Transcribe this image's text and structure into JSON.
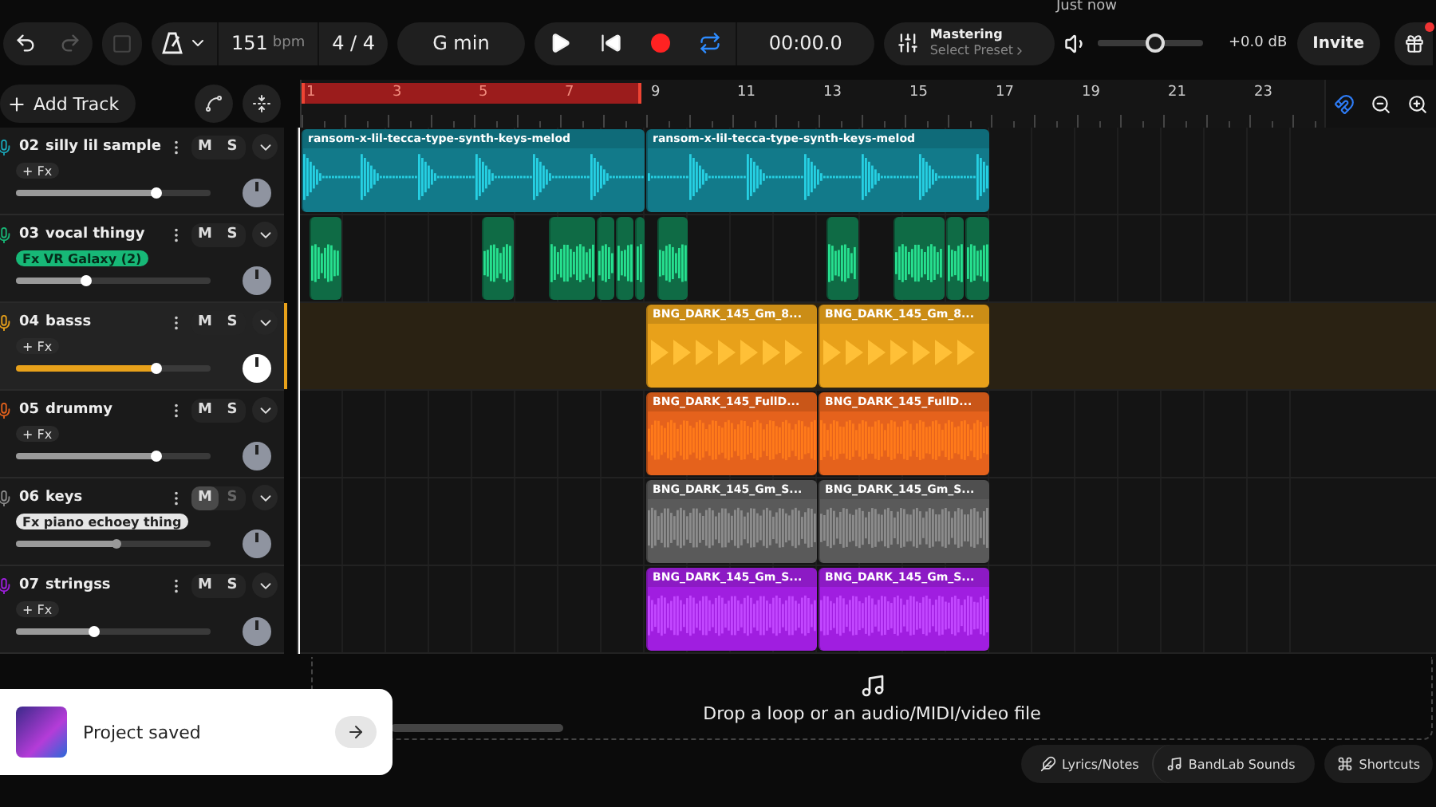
{
  "top_strip": {
    "status": "Just now"
  },
  "toolbar": {
    "tempo": "151",
    "tempo_unit": "bpm",
    "time_signature": "4 / 4",
    "key": "G min",
    "loop_on": true,
    "time": "00:00.0",
    "mastering": {
      "title": "Mastering",
      "preset": "Select Preset"
    },
    "master_volume": {
      "level": 0.55,
      "reading": "+0.0 dB"
    },
    "invite": "Invite"
  },
  "track_header": {
    "add_track": "Add Track"
  },
  "ruler": {
    "bars": [
      "1",
      "3",
      "5",
      "7",
      "9",
      "11",
      "13",
      "15",
      "17",
      "19",
      "21",
      "23"
    ],
    "loop_region": {
      "level": 0.333
    }
  },
  "tracks": [
    {
      "number": "02",
      "name": "silly lil sample",
      "color": "#1aa6b8",
      "fx": {
        "kind": "add",
        "label": "+ Fx"
      },
      "muted": false,
      "selected": false,
      "level": 0.72,
      "mute_label": "M",
      "solo_label": "S",
      "clips": [
        {
          "label": "ransom-x-lil-tecca-type-synth-keys-melod"
        },
        {
          "label": "ransom-x-lil-tecca-type-synth-keys-melod"
        }
      ]
    },
    {
      "number": "03",
      "name": "vocal thingy",
      "color": "#17b877",
      "fx": {
        "kind": "chip",
        "label": "Fx VR Galaxy (2)"
      },
      "muted": false,
      "selected": false,
      "level": 0.36,
      "mute_label": "M",
      "solo_label": "S"
    },
    {
      "number": "04",
      "name": "basss",
      "color": "#e8a11a",
      "fx": {
        "kind": "add",
        "label": "+ Fx"
      },
      "muted": false,
      "selected": true,
      "level": 0.72,
      "mute_label": "M",
      "solo_label": "S",
      "clips": [
        {
          "label": "BNG_DARK_145_Gm_8..."
        },
        {
          "label": "BNG_DARK_145_Gm_8..."
        }
      ]
    },
    {
      "number": "05",
      "name": "drummy",
      "color": "#e5621c",
      "fx": {
        "kind": "add",
        "label": "+ Fx"
      },
      "muted": false,
      "selected": false,
      "level": 0.72,
      "mute_label": "M",
      "solo_label": "S",
      "clips": [
        {
          "label": "BNG_DARK_145_FullD..."
        },
        {
          "label": "BNG_DARK_145_FullD..."
        }
      ]
    },
    {
      "number": "06",
      "name": "keys",
      "color": "#8a8a8a",
      "fx": {
        "kind": "chip",
        "label": "Fx piano echoey thing"
      },
      "muted": true,
      "selected": false,
      "level": 0.52,
      "mute_label": "M",
      "solo_label": "S",
      "clips": [
        {
          "label": "BNG_DARK_145_Gm_S..."
        },
        {
          "label": "BNG_DARK_145_Gm_S..."
        }
      ]
    },
    {
      "number": "07",
      "name": "stringss",
      "color": "#a01ee0",
      "fx": {
        "kind": "add",
        "label": "+ Fx"
      },
      "muted": false,
      "selected": false,
      "level": 0.4,
      "mute_label": "M",
      "solo_label": "S",
      "clips": [
        {
          "label": "BNG_DARK_145_Gm_S..."
        },
        {
          "label": "BNG_DARK_145_Gm_S..."
        }
      ]
    }
  ],
  "drop_zone": {
    "text": "Drop a loop or an audio/MIDI/video file"
  },
  "footer": {
    "buttons": [
      "Lyrics/Notes",
      "BandLab Sounds",
      "Shortcuts"
    ]
  },
  "toast": {
    "text": "Project saved"
  }
}
